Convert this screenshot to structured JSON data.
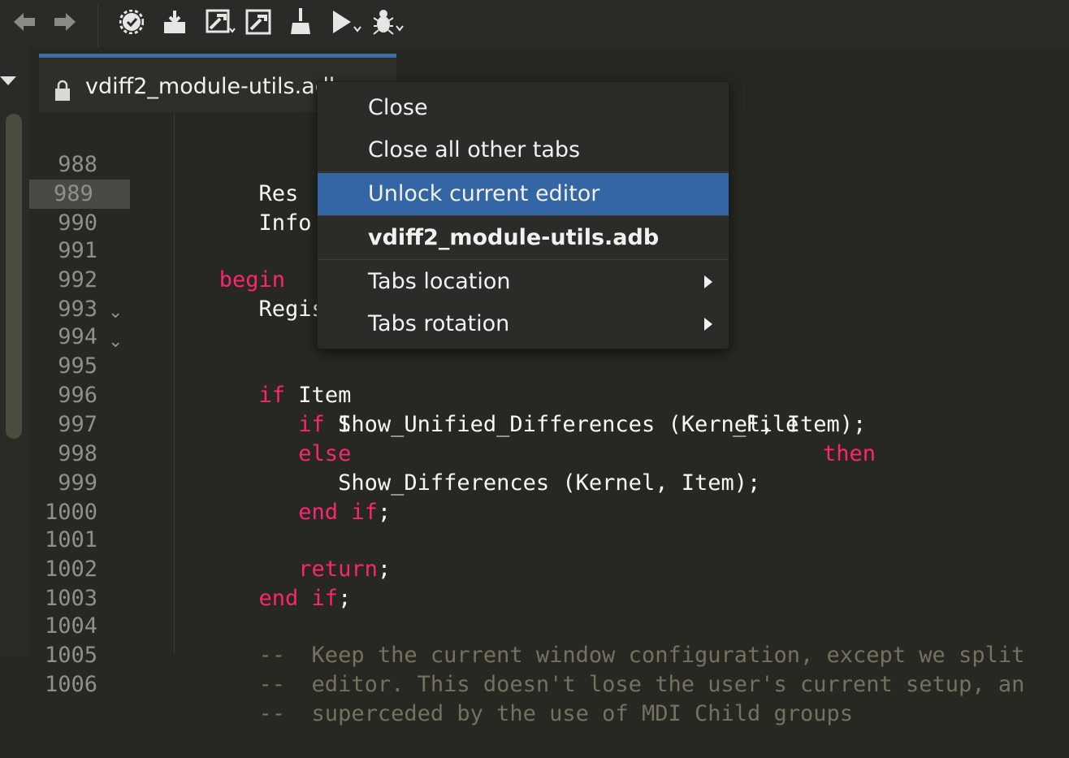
{
  "toolbar": {
    "icons": [
      "back-arrow-icon",
      "forward-arrow-icon",
      "build-settings-icon",
      "install-icon",
      "build-main-icon",
      "build-all-icon",
      "clean-icon",
      "run-icon",
      "debug-icon"
    ]
  },
  "tab": {
    "label": "vdiff2_module-utils.adb"
  },
  "editor": {
    "lines": [
      {
        "n": "988",
        "code": "      Res  : "
      },
      {
        "n": "989",
        "code": "      Info : "
      },
      {
        "n": "990",
        "code": ""
      },
      {
        "n": "991",
        "code": "   begin"
      },
      {
        "n": "992",
        "code": "      Registe"
      },
      {
        "n": "993",
        "code": ""
      },
      {
        "n": "994",
        "code": "      if Item"
      },
      {
        "n": "995",
        "code": "         if I"
      },
      {
        "n": "996",
        "code": "            Show_Unified_Differences (Kernel, Item);"
      },
      {
        "n": "997",
        "code": "         else"
      },
      {
        "n": "998",
        "code": "            Show_Differences (Kernel, Item);"
      },
      {
        "n": "999",
        "code": "         end if;"
      },
      {
        "n": "1000",
        "code": ""
      },
      {
        "n": "1001",
        "code": "         return;"
      },
      {
        "n": "1002",
        "code": "      end if;"
      },
      {
        "n": "1003",
        "code": ""
      },
      {
        "n": "1004",
        "code": "      --  Keep the current window configuration, except we split"
      },
      {
        "n": "1005",
        "code": "      --  editor. This doesn't lose the user's current setup, an"
      },
      {
        "n": "1006",
        "code": "      --  superceded by the use of MDI Child groups"
      }
    ],
    "line994_tail": "_File",
    "line994_kw": "then"
  },
  "context_menu": {
    "items": [
      {
        "label": "Close"
      },
      {
        "label": "Close all other tabs"
      },
      {
        "label": "Unlock current editor"
      },
      {
        "label": "vdiff2_module-utils.adb"
      },
      {
        "label": "Tabs location"
      },
      {
        "label": "Tabs rotation"
      }
    ]
  },
  "colors": {
    "accent": "#3465a4",
    "keyword": "#f92672",
    "comment": "#75715e",
    "background": "#272822"
  }
}
